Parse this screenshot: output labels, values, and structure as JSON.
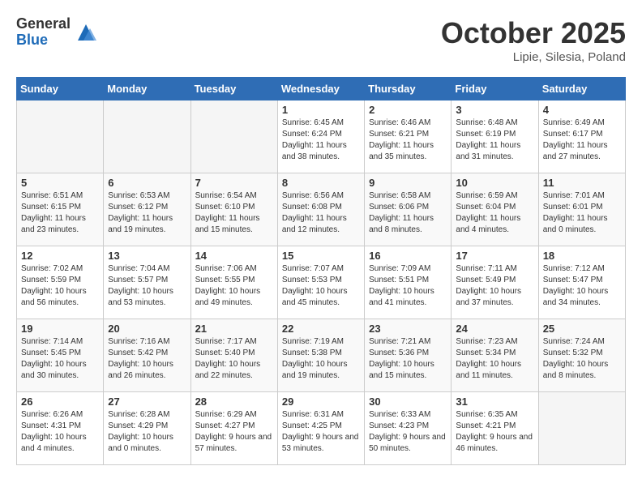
{
  "header": {
    "logo_general": "General",
    "logo_blue": "Blue",
    "month_title": "October 2025",
    "subtitle": "Lipie, Silesia, Poland"
  },
  "days_of_week": [
    "Sunday",
    "Monday",
    "Tuesday",
    "Wednesday",
    "Thursday",
    "Friday",
    "Saturday"
  ],
  "weeks": [
    [
      {
        "day": "",
        "info": ""
      },
      {
        "day": "",
        "info": ""
      },
      {
        "day": "",
        "info": ""
      },
      {
        "day": "1",
        "info": "Sunrise: 6:45 AM\nSunset: 6:24 PM\nDaylight: 11 hours\nand 38 minutes."
      },
      {
        "day": "2",
        "info": "Sunrise: 6:46 AM\nSunset: 6:21 PM\nDaylight: 11 hours\nand 35 minutes."
      },
      {
        "day": "3",
        "info": "Sunrise: 6:48 AM\nSunset: 6:19 PM\nDaylight: 11 hours\nand 31 minutes."
      },
      {
        "day": "4",
        "info": "Sunrise: 6:49 AM\nSunset: 6:17 PM\nDaylight: 11 hours\nand 27 minutes."
      }
    ],
    [
      {
        "day": "5",
        "info": "Sunrise: 6:51 AM\nSunset: 6:15 PM\nDaylight: 11 hours\nand 23 minutes."
      },
      {
        "day": "6",
        "info": "Sunrise: 6:53 AM\nSunset: 6:12 PM\nDaylight: 11 hours\nand 19 minutes."
      },
      {
        "day": "7",
        "info": "Sunrise: 6:54 AM\nSunset: 6:10 PM\nDaylight: 11 hours\nand 15 minutes."
      },
      {
        "day": "8",
        "info": "Sunrise: 6:56 AM\nSunset: 6:08 PM\nDaylight: 11 hours\nand 12 minutes."
      },
      {
        "day": "9",
        "info": "Sunrise: 6:58 AM\nSunset: 6:06 PM\nDaylight: 11 hours\nand 8 minutes."
      },
      {
        "day": "10",
        "info": "Sunrise: 6:59 AM\nSunset: 6:04 PM\nDaylight: 11 hours\nand 4 minutes."
      },
      {
        "day": "11",
        "info": "Sunrise: 7:01 AM\nSunset: 6:01 PM\nDaylight: 11 hours\nand 0 minutes."
      }
    ],
    [
      {
        "day": "12",
        "info": "Sunrise: 7:02 AM\nSunset: 5:59 PM\nDaylight: 10 hours\nand 56 minutes."
      },
      {
        "day": "13",
        "info": "Sunrise: 7:04 AM\nSunset: 5:57 PM\nDaylight: 10 hours\nand 53 minutes."
      },
      {
        "day": "14",
        "info": "Sunrise: 7:06 AM\nSunset: 5:55 PM\nDaylight: 10 hours\nand 49 minutes."
      },
      {
        "day": "15",
        "info": "Sunrise: 7:07 AM\nSunset: 5:53 PM\nDaylight: 10 hours\nand 45 minutes."
      },
      {
        "day": "16",
        "info": "Sunrise: 7:09 AM\nSunset: 5:51 PM\nDaylight: 10 hours\nand 41 minutes."
      },
      {
        "day": "17",
        "info": "Sunrise: 7:11 AM\nSunset: 5:49 PM\nDaylight: 10 hours\nand 37 minutes."
      },
      {
        "day": "18",
        "info": "Sunrise: 7:12 AM\nSunset: 5:47 PM\nDaylight: 10 hours\nand 34 minutes."
      }
    ],
    [
      {
        "day": "19",
        "info": "Sunrise: 7:14 AM\nSunset: 5:45 PM\nDaylight: 10 hours\nand 30 minutes."
      },
      {
        "day": "20",
        "info": "Sunrise: 7:16 AM\nSunset: 5:42 PM\nDaylight: 10 hours\nand 26 minutes."
      },
      {
        "day": "21",
        "info": "Sunrise: 7:17 AM\nSunset: 5:40 PM\nDaylight: 10 hours\nand 22 minutes."
      },
      {
        "day": "22",
        "info": "Sunrise: 7:19 AM\nSunset: 5:38 PM\nDaylight: 10 hours\nand 19 minutes."
      },
      {
        "day": "23",
        "info": "Sunrise: 7:21 AM\nSunset: 5:36 PM\nDaylight: 10 hours\nand 15 minutes."
      },
      {
        "day": "24",
        "info": "Sunrise: 7:23 AM\nSunset: 5:34 PM\nDaylight: 10 hours\nand 11 minutes."
      },
      {
        "day": "25",
        "info": "Sunrise: 7:24 AM\nSunset: 5:32 PM\nDaylight: 10 hours\nand 8 minutes."
      }
    ],
    [
      {
        "day": "26",
        "info": "Sunrise: 6:26 AM\nSunset: 4:31 PM\nDaylight: 10 hours\nand 4 minutes."
      },
      {
        "day": "27",
        "info": "Sunrise: 6:28 AM\nSunset: 4:29 PM\nDaylight: 10 hours\nand 0 minutes."
      },
      {
        "day": "28",
        "info": "Sunrise: 6:29 AM\nSunset: 4:27 PM\nDaylight: 9 hours\nand 57 minutes."
      },
      {
        "day": "29",
        "info": "Sunrise: 6:31 AM\nSunset: 4:25 PM\nDaylight: 9 hours\nand 53 minutes."
      },
      {
        "day": "30",
        "info": "Sunrise: 6:33 AM\nSunset: 4:23 PM\nDaylight: 9 hours\nand 50 minutes."
      },
      {
        "day": "31",
        "info": "Sunrise: 6:35 AM\nSunset: 4:21 PM\nDaylight: 9 hours\nand 46 minutes."
      },
      {
        "day": "",
        "info": ""
      }
    ]
  ]
}
